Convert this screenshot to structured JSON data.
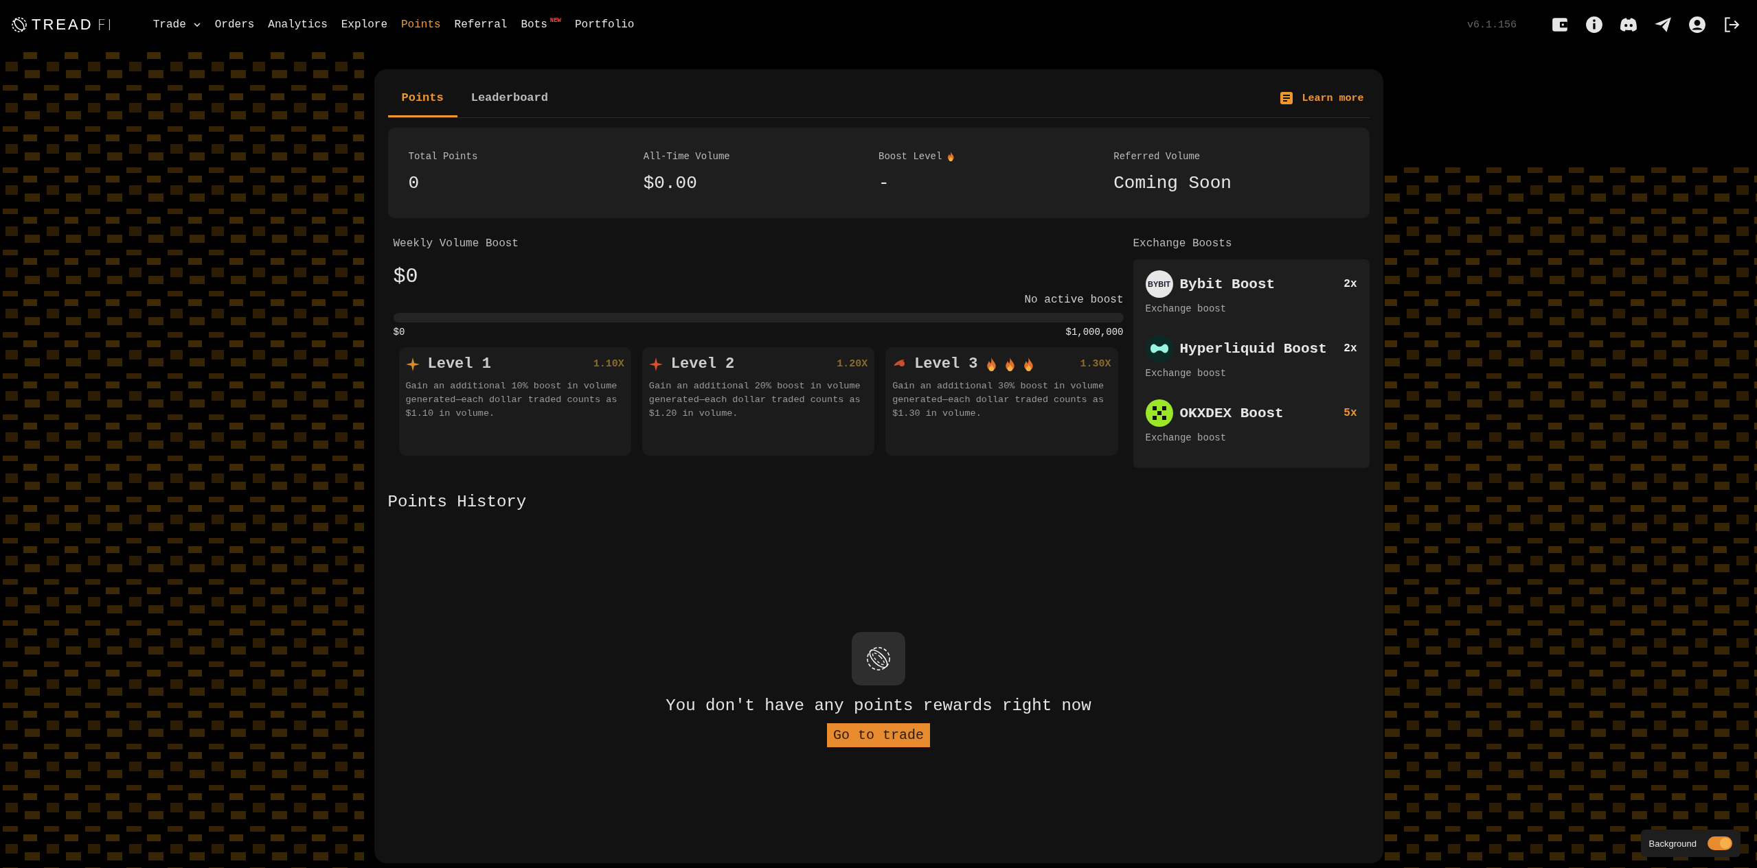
{
  "logo": {
    "name": "TREAD",
    "suffix": "FI"
  },
  "nav": [
    {
      "label": "Trade",
      "selected": false,
      "dropdown": true
    },
    {
      "label": "Orders",
      "selected": false
    },
    {
      "label": "Analytics",
      "selected": false
    },
    {
      "label": "Explore",
      "selected": false
    },
    {
      "label": "Points",
      "selected": true
    },
    {
      "label": "Referral",
      "selected": false
    },
    {
      "label": "Bots",
      "selected": false,
      "badge": "NEW"
    },
    {
      "label": "Portfolio",
      "selected": false
    }
  ],
  "version": "v6.1.156",
  "tabs": [
    {
      "label": "Points",
      "selected": true
    },
    {
      "label": "Leaderboard",
      "selected": false
    }
  ],
  "learn_more": "Learn more",
  "stats": [
    {
      "label": "Total Points",
      "value": "0"
    },
    {
      "label": "All-Time Volume",
      "value": "$0.00"
    },
    {
      "label": "Boost Level",
      "value": "-",
      "flame": true
    },
    {
      "label": "Referred Volume",
      "value": "Coming Soon"
    }
  ],
  "weekly_boost": {
    "title": "Weekly Volume Boost",
    "value": "$0",
    "status": "No active boost",
    "level": 0,
    "min": "$0",
    "max": "$1,000,000"
  },
  "levels": [
    {
      "kind": "star",
      "color": "#d98a2b",
      "title": "Level 1",
      "multiplier": "1.10X",
      "description": "Gain an additional 10% boost in volume generated—each dollar traded counts as $1.10 in volume."
    },
    {
      "kind": "star",
      "color": "#d9502b",
      "title": "Level 2",
      "multiplier": "1.20X",
      "description": "Gain an additional 20% boost in volume generated—each dollar traded counts as $1.20 in volume."
    },
    {
      "kind": "comet",
      "color": "#c8502a",
      "title": "Level 3",
      "multiplier": "1.30X",
      "fire": true,
      "description": "Gain an additional 30% boost in volume generated—each dollar traded counts as $1.30 in volume."
    }
  ],
  "exchange_boosts": {
    "title": "Exchange Boosts",
    "items": [
      {
        "kind": "bybit",
        "logo_text": "BYBIT",
        "name": "Bybit Boost",
        "multiplier": "2x",
        "highlight": false,
        "subtitle": "Exchange boost"
      },
      {
        "kind": "hyperliquid",
        "name": "Hyperliquid Boost",
        "multiplier": "2x",
        "highlight": false,
        "subtitle": "Exchange boost"
      },
      {
        "kind": "okx",
        "name": "OKXDEX Boost",
        "multiplier": "5x",
        "highlight": true,
        "subtitle": "Exchange boost"
      }
    ]
  },
  "history": {
    "title": "Points History",
    "empty_message": "You don't have any points rewards right now",
    "button": "Go to trade"
  },
  "background_toggle": {
    "label": "Background",
    "on": true
  }
}
